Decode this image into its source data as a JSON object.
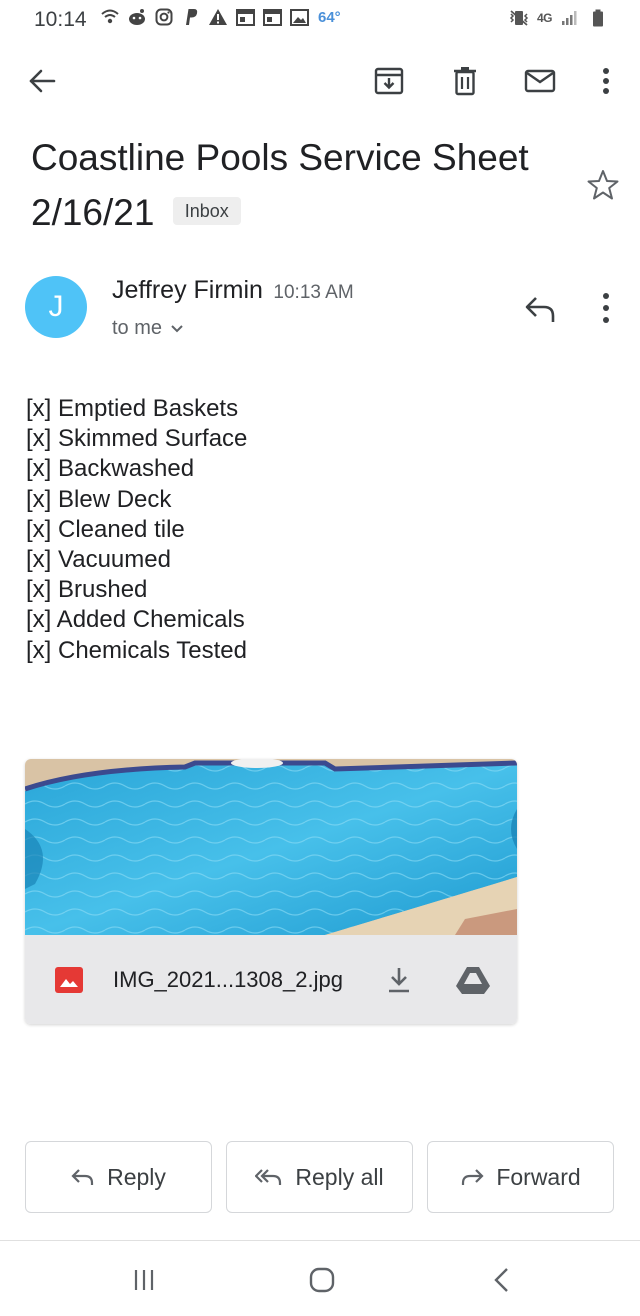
{
  "status_bar": {
    "time": "10:14",
    "temperature": "64°",
    "network": "4G",
    "icons_left": [
      "wifi-calling-icon",
      "reddit-icon",
      "instagram-icon",
      "paypal-icon",
      "alert-icon",
      "calendar-icon",
      "calendar-icon",
      "gallery-icon"
    ],
    "icons_right": [
      "vibrate-mute-icon",
      "signal-icon",
      "battery-icon"
    ]
  },
  "toolbar": {
    "icons": [
      "back-arrow-icon",
      "archive-icon",
      "delete-icon",
      "mark-unread-icon",
      "more-vert-icon"
    ]
  },
  "email": {
    "subject": "Coastline Pools Service Sheet 2/16/21",
    "label": "Inbox",
    "sender_initial": "J",
    "sender_name": "Jeffrey Firmin",
    "time": "10:13 AM",
    "recipient": "to me",
    "body_lines": [
      "[x] Emptied Baskets",
      "[x] Skimmed Surface",
      "[x] Backwashed",
      "[x] Blew Deck",
      "[x] Cleaned tile",
      "[x] Vacuumed",
      "[x] Brushed",
      "[x] Added Chemicals",
      "[x] Chemicals Tested"
    ],
    "attachment": {
      "name": "IMG_2021...1308_2.jpg"
    }
  },
  "actions": {
    "reply": "Reply",
    "reply_all": "Reply all",
    "forward": "Forward"
  },
  "colors": {
    "avatar": "#4fc3f7",
    "attachment_icon": "#e53935",
    "status_temp": "#4a90d9"
  }
}
